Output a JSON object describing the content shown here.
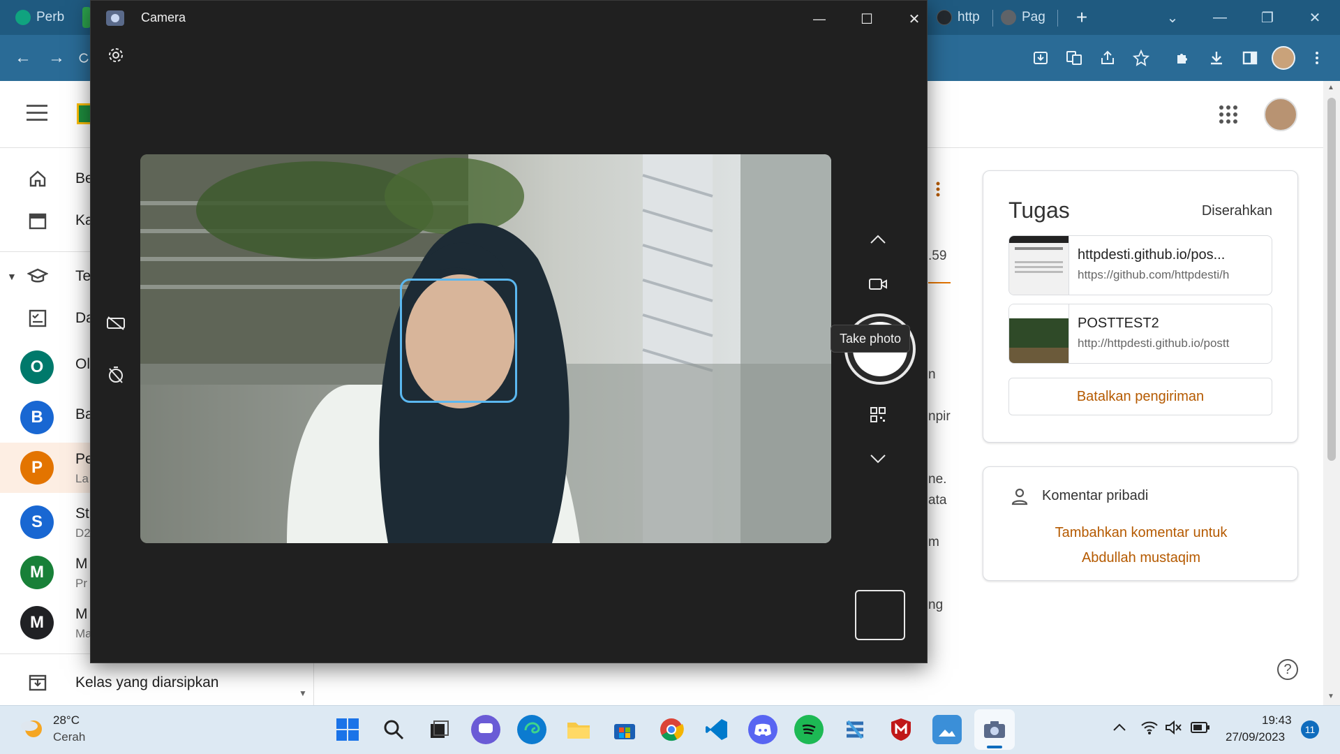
{
  "browser": {
    "tabs": [
      {
        "label": "Perb",
        "color": "#10a37f"
      },
      {
        "label": "http",
        "color": "#24292e"
      },
      {
        "label": "Pag",
        "color": "#5f6368"
      }
    ],
    "new_tab_label": "+",
    "toolbar": {
      "back": "←",
      "forward": "→"
    },
    "window_controls": {
      "dropdown": "⌄",
      "minimize": "—",
      "restore": "❐",
      "close": "✕"
    }
  },
  "classroom": {
    "menu_icon": "hamburger-icon",
    "sidebar": {
      "items": [
        {
          "label": "Be",
          "icon": "home-icon"
        },
        {
          "label": "Ka",
          "icon": "calendar-icon"
        },
        {
          "label": "Te",
          "icon": "school-icon"
        },
        {
          "label": "Da",
          "icon": "todo-icon"
        }
      ],
      "classes": [
        {
          "initial": "O",
          "label": "Ol",
          "sub": "",
          "color": "#00796b"
        },
        {
          "initial": "B",
          "label": "Ba",
          "sub": "",
          "color": "#1967d2"
        },
        {
          "initial": "P",
          "label": "Pe",
          "sub": "La",
          "color": "#e37400"
        },
        {
          "initial": "S",
          "label": "St",
          "sub": "D2",
          "color": "#1967d2"
        },
        {
          "initial": "M",
          "label": "M",
          "sub": "Pr",
          "color": "#188038"
        },
        {
          "initial": "M",
          "label": "M",
          "sub": "Ma",
          "color": "#202124"
        }
      ],
      "archived_label": "Kelas yang diarsipkan"
    },
    "partial_text": [
      ".59",
      "n",
      "npir",
      "ne.",
      "ata",
      "m",
      "ng"
    ],
    "tugas_card": {
      "title": "Tugas",
      "status": "Diserahkan",
      "attachments": [
        {
          "title": "httpdesti.github.io/pos...",
          "url": "https://github.com/httpdesti/h"
        },
        {
          "title": "POSTTEST2",
          "url": "http://httpdesti.github.io/postt"
        }
      ],
      "cancel_button": "Batalkan pengiriman"
    },
    "comment_card": {
      "title": "Komentar pribadi",
      "add_link_line1": "Tambahkan komentar untuk",
      "add_link_line2": "Abdullah mustaqim"
    },
    "help_icon": "?",
    "accent_color": "#b55a00"
  },
  "camera": {
    "title": "Camera",
    "window_controls": {
      "minimize": "—",
      "maximize": "☐",
      "close": "✕"
    },
    "tooltip": "Take photo",
    "face_box_color": "#5bb8f0"
  },
  "taskbar": {
    "weather_temp": "28°C",
    "weather_desc": "Cerah",
    "time": "19:43",
    "date": "27/09/2023",
    "notification_count": "11",
    "apps": [
      "start",
      "search",
      "task-view",
      "chat",
      "edge",
      "file-explorer",
      "store",
      "chrome",
      "vscode",
      "discord",
      "spotify",
      "app",
      "mcafee",
      "photos",
      "camera"
    ]
  }
}
